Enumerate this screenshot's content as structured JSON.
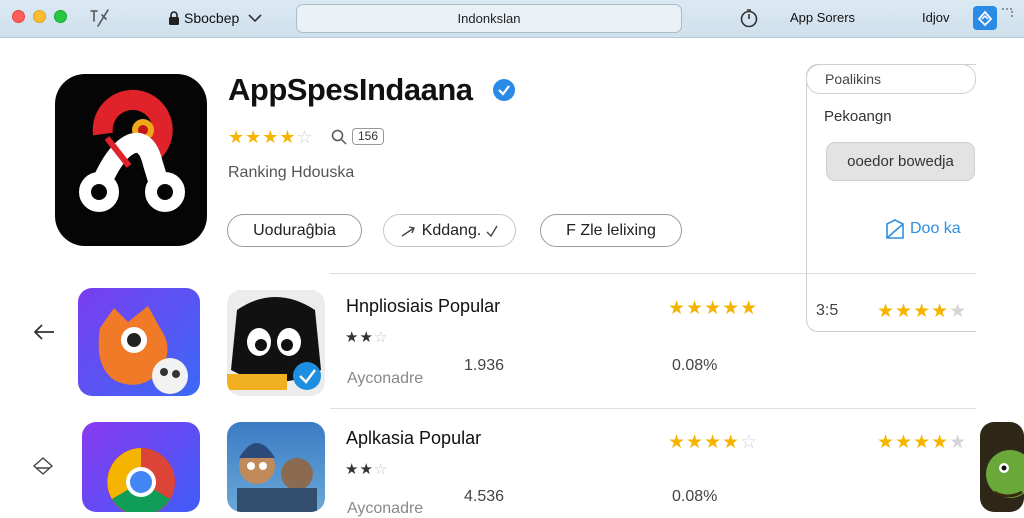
{
  "titlebar": {
    "title": "Sbocbep",
    "search_text": "Indonkslan",
    "app_stores": "App Sorers",
    "user": "Idjov"
  },
  "hero": {
    "app_name": "AppSpesIndaana",
    "rating_stars": 4,
    "rating_count": "156",
    "subtitle": "Ranking Hdouska",
    "buttons": [
      "Uoduraĝbia",
      "Kddang.",
      "F Zle lelixing"
    ]
  },
  "panel": {
    "top_label": "Poalikins",
    "row2": "Pekoangn",
    "button": "ooedor bowedja",
    "link": "Doo ka"
  },
  "rows": [
    {
      "title": "Hnpliosiais Popular",
      "small_stars": 2,
      "category": "Ayconadre",
      "downloads": "1.936",
      "share": "0.08%",
      "rating": 5,
      "side_value": "3:5",
      "side_rating": 4
    },
    {
      "title": "Aplkasia Popular",
      "small_stars": 2,
      "category": "Ayconadre",
      "downloads": "4.536",
      "share": "0.08%",
      "rating": 4,
      "side_value": "",
      "side_rating": 4
    }
  ],
  "colors": {
    "accent": "#2a8be6",
    "star": "#f5b400",
    "titlebar": "#d6e6f1"
  },
  "icons": [
    "close-traffic-icon",
    "minimize-traffic-icon",
    "zoom-traffic-icon",
    "slash-icon",
    "lock-icon",
    "chevron-down-icon",
    "clock-icon",
    "share-icon",
    "magnifier-icon",
    "verified-badge-icon",
    "back-arrow-icon",
    "diamond-icon",
    "external-link-icon"
  ]
}
